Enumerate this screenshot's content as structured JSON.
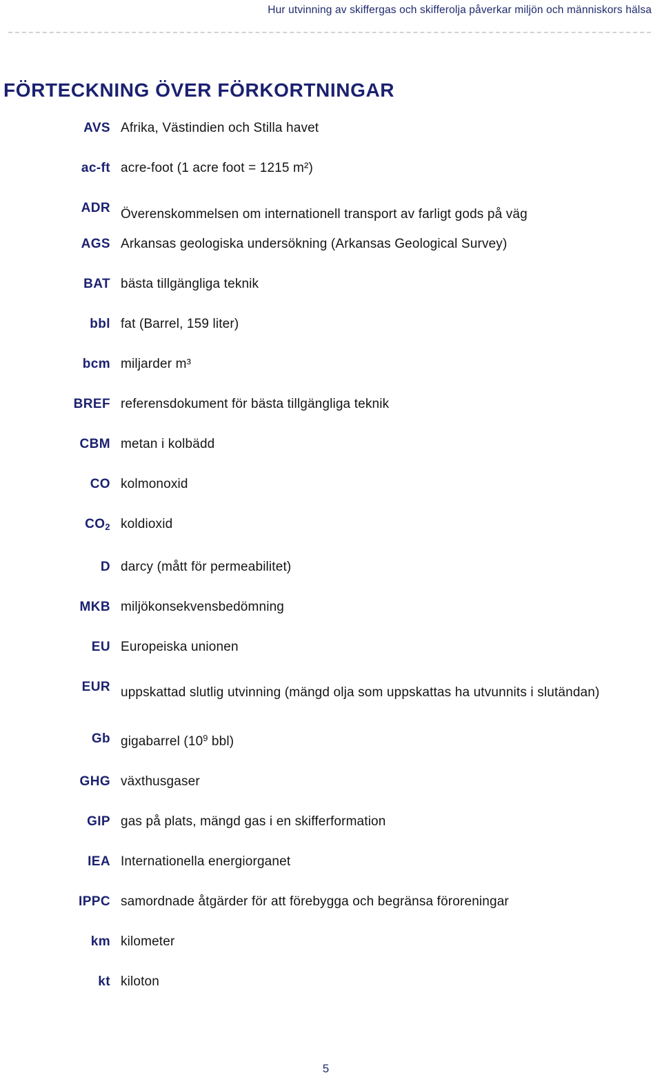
{
  "header": {
    "running_title": "Hur utvinning av skiffergas och skifferolja påverkar miljön och människors hälsa"
  },
  "title": "FÖRTECKNING ÖVER FÖRKORTNINGAR",
  "colors": {
    "heading_blue": "#1b2170",
    "term_blue": "#1b2170",
    "body_text": "#151515",
    "rule_gray": "#d2d2d2",
    "page_background": "#ffffff"
  },
  "abbreviations": [
    {
      "term": "AVS",
      "definition": "Afrika, Västindien och Stilla havet"
    },
    {
      "term": "ac-ft",
      "definition": "acre-foot (1 acre foot = 1215 m²)"
    },
    {
      "term": "ADR",
      "definition": "Överenskommelsen om internationell transport av farligt gods på väg"
    },
    {
      "term": "AGS",
      "definition": "Arkansas geologiska undersökning (Arkansas Geological Survey)"
    },
    {
      "term": "BAT",
      "definition": "bästa tillgängliga teknik"
    },
    {
      "term": "bbl",
      "definition": "fat (Barrel, 159 liter)"
    },
    {
      "term": "bcm",
      "definition": "miljarder m³"
    },
    {
      "term": "BREF",
      "definition": "referensdokument för bästa tillgängliga teknik"
    },
    {
      "term": "CBM",
      "definition": "metan i kolbädd"
    },
    {
      "term": "CO",
      "definition": "kolmonoxid"
    },
    {
      "term": "CO2",
      "definition": "koldioxid"
    },
    {
      "term": "D",
      "definition": "darcy (mått för permeabilitet)"
    },
    {
      "term": "MKB",
      "definition": "miljökonsekvensbedömning"
    },
    {
      "term": "EU",
      "definition": "Europeiska unionen"
    },
    {
      "term": "EUR",
      "definition": "uppskattad slutlig utvinning (mängd olja som uppskattas ha utvunnits i slutändan)"
    },
    {
      "term": "Gb",
      "definition": "gigabarrel (10⁹ bbl)"
    },
    {
      "term": "GHG",
      "definition": "växthusgaser"
    },
    {
      "term": "GIP",
      "definition": "gas på plats, mängd gas i en skifferformation"
    },
    {
      "term": "IEA",
      "definition": "Internationella energiorganet"
    },
    {
      "term": "IPPC",
      "definition": "samordnade åtgärder för att förebygga och begränsa föroreningar"
    },
    {
      "term": "km",
      "definition": "kilometer"
    },
    {
      "term": "kt",
      "definition": "kiloton"
    }
  ],
  "page_number": "5"
}
